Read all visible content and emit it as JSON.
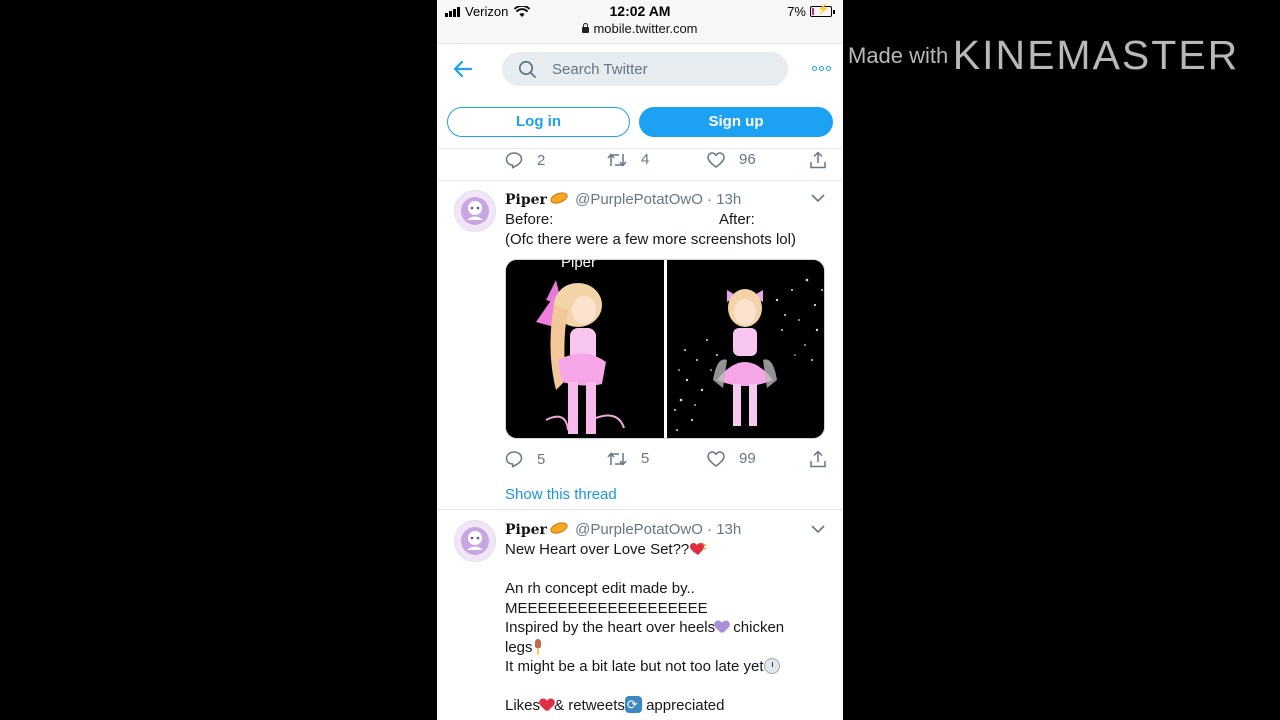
{
  "status_bar": {
    "carrier": "Verizon",
    "time": "12:02 AM",
    "battery": "7%",
    "url": "mobile.twitter.com"
  },
  "nav": {
    "search_placeholder": "Search Twitter",
    "login_label": "Log in",
    "signup_label": "Sign up"
  },
  "prev_tweet_actions": {
    "replies": "2",
    "retweets": "4",
    "likes": "96"
  },
  "tweets": [
    {
      "name": "Piper",
      "handle": "@PurplePotatOwO",
      "time": "13h",
      "text_line1_before": "Before:",
      "text_line1_after": "After:",
      "text_line2": "(Ofc there were a few more screenshots lol)",
      "image_label": "Piper",
      "replies": "5",
      "retweets": "5",
      "likes": "99",
      "show_thread": "Show this thread"
    },
    {
      "name": "Piper",
      "handle": "@PurplePotatOwO",
      "time": "13h",
      "line1": "New Heart over Love Set??",
      "line2": "An rh concept edit made by..",
      "line3": "MEEEEEEEEEEEEEEEEEEE",
      "line4a": "Inspired by the heart over heels",
      "line4b": " chicken",
      "line5": "legs",
      "line6": "It might be a bit late but not too late yet",
      "line7a": "Likes",
      "line7b": "& retweets",
      "line7c": " appreciated"
    }
  ],
  "watermark": {
    "made_with": "Made with",
    "brand": "KINEMASTER"
  },
  "colors": {
    "accent": "#1da1f2",
    "text": "#14171a",
    "muted": "#657786",
    "border": "#e1e8ed"
  }
}
